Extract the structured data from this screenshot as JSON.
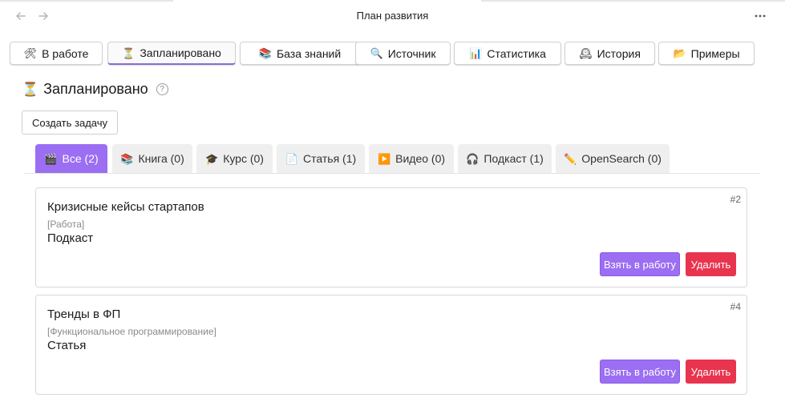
{
  "window": {
    "title": "План развития",
    "back_icon": "arrow-left-icon",
    "forward_icon": "arrow-right-icon",
    "more_icon": "more-horizontal-icon"
  },
  "top_tabs": [
    {
      "icon": "🛠",
      "label": "В работе"
    },
    {
      "icon": "⏳",
      "label": "Запланировано",
      "active": true
    },
    {
      "icon": "📚",
      "label": "База знаний"
    },
    {
      "icon": "🔍",
      "label": "Источник"
    },
    {
      "icon": "📊",
      "label": "Статистика"
    },
    {
      "icon": "🕰",
      "label": "История"
    },
    {
      "icon": "📂",
      "label": "Примеры"
    }
  ],
  "page": {
    "icon": "⏳",
    "title": "Запланировано",
    "help": "?",
    "create_button": "Создать задачу"
  },
  "categories": [
    {
      "icon": "🎬",
      "label": "Все (2)",
      "active": true
    },
    {
      "icon": "📚",
      "label": "Книга (0)"
    },
    {
      "icon": "🎓",
      "label": "Курс (0)"
    },
    {
      "icon": "📄",
      "label": "Статья (1)"
    },
    {
      "icon": "▶️",
      "label": "Видео (0)"
    },
    {
      "icon": "🎧",
      "label": "Подкаст (1)"
    },
    {
      "icon": "✏️",
      "label": "OpenSearch (0)"
    }
  ],
  "tasks": [
    {
      "num": "#2",
      "title": "Кризисные кейсы стартапов",
      "tag": "[Работа]",
      "type": "Подкаст",
      "take": "Взять в работу",
      "delete": "Удалить"
    },
    {
      "num": "#4",
      "title": "Тренды в ФП",
      "tag": "[Функциональное программирование]",
      "type": "Статья",
      "take": "Взять в работу",
      "delete": "Удалить"
    }
  ],
  "colors": {
    "accent": "#9b6ef3",
    "danger": "#e8344e"
  }
}
